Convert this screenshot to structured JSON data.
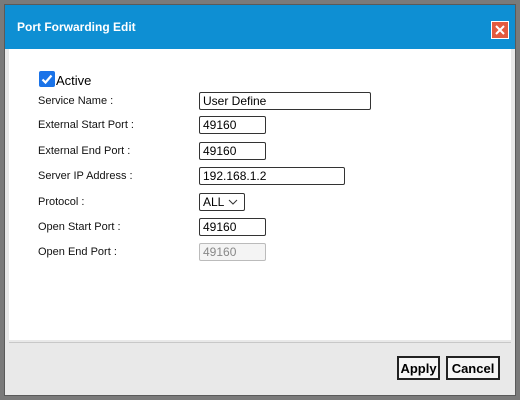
{
  "dialog": {
    "title": "Port Forwarding Edit",
    "close_icon": "close-icon"
  },
  "active": {
    "label": "Active",
    "checked": true
  },
  "fields": {
    "service_name": {
      "label": "Service Name :",
      "value": "User Define"
    },
    "external_start_port": {
      "label": "External Start Port :",
      "value": "49160"
    },
    "external_end_port": {
      "label": "External End Port :",
      "value": "49160"
    },
    "server_ip": {
      "label": "Server IP Address :",
      "value": "192.168.1.2"
    },
    "protocol": {
      "label": "Protocol :",
      "value": "ALL"
    },
    "open_start_port": {
      "label": "Open Start Port :",
      "value": "49160"
    },
    "open_end_port": {
      "label": "Open End Port :",
      "value": "49160",
      "disabled": true
    }
  },
  "buttons": {
    "apply": "Apply",
    "cancel": "Cancel"
  },
  "colors": {
    "titlebar": "#0e8fd3",
    "checkbox": "#1a73e8",
    "close": "#e25a3e"
  }
}
